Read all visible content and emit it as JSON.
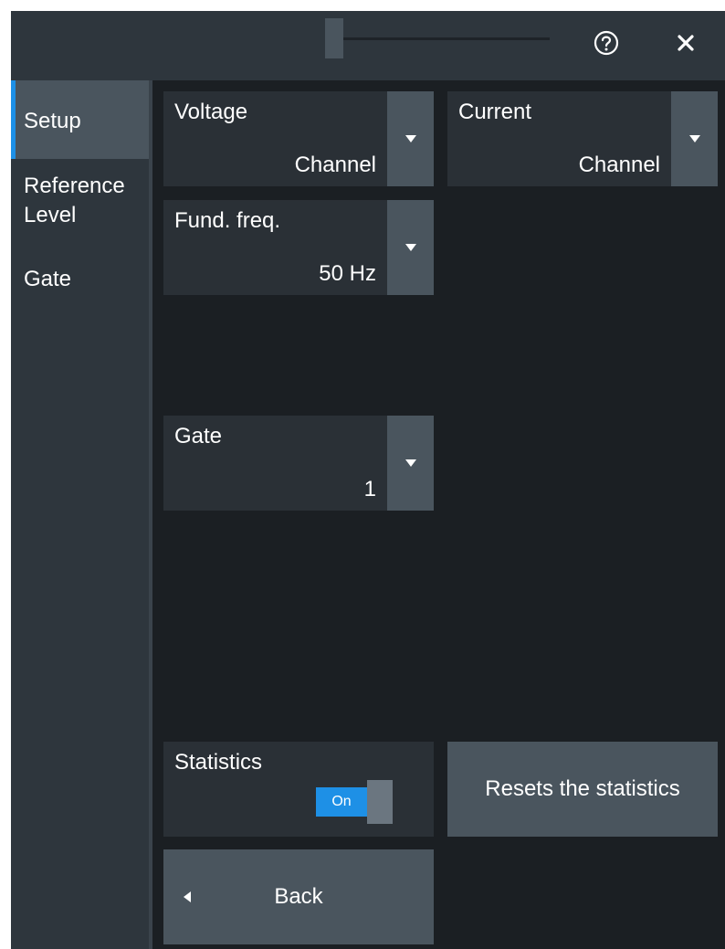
{
  "dialog": {
    "help_icon": "help-circle-icon",
    "close_icon": "close-icon"
  },
  "sidebar": {
    "items": [
      {
        "label": "Setup",
        "active": true
      },
      {
        "label": "Reference Level",
        "active": false
      },
      {
        "label": "Gate",
        "active": false
      }
    ]
  },
  "setup": {
    "voltage": {
      "label": "Voltage",
      "value": "Channel"
    },
    "current": {
      "label": "Current",
      "value": "Channel"
    },
    "fund_freq": {
      "label": "Fund. freq.",
      "value": "50 Hz"
    },
    "gate": {
      "label": "Gate",
      "value": "1"
    },
    "statistics": {
      "label": "Statistics",
      "state": "On"
    },
    "reset_label": "Resets the statistics",
    "back_label": "Back"
  },
  "colors": {
    "accent": "#1e90e6",
    "panel": "#1b1f23",
    "tile": "#2a3036",
    "button": "#4a555e"
  }
}
